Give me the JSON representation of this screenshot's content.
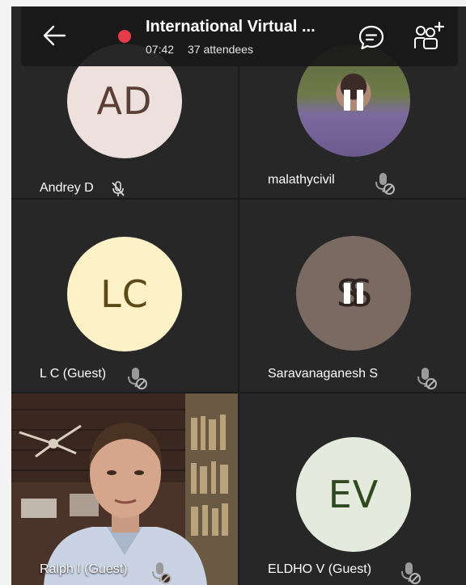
{
  "header": {
    "title": "International Virtual ...",
    "time": "07:42",
    "attendees": "37 attendees"
  },
  "participants": [
    {
      "name": "Andrey D",
      "initials": "AD",
      "mic": "muted-inline",
      "avatar_color": "#ede0dd"
    },
    {
      "name": "malathycivil",
      "initials": "",
      "mic": "muted",
      "video": "paused"
    },
    {
      "name": "L C (Guest)",
      "initials": "LC",
      "mic": "muted",
      "avatar_color": "#fdf1c8"
    },
    {
      "name": "Saravanaganesh S",
      "initials": "SS",
      "mic": "muted",
      "video": "paused",
      "avatar_color": "#7b6a62"
    },
    {
      "name": "Ralph I (Guest)",
      "initials": "",
      "mic": "muted",
      "video": "on"
    },
    {
      "name": "ELDHO V (Guest)",
      "initials": "EV",
      "mic": "muted",
      "avatar_color": "#e4ebdc"
    }
  ],
  "icons": {
    "back": "arrow-left-icon",
    "recording": "recording-dot-icon",
    "chat": "chat-bubble-icon",
    "people": "people-add-icon",
    "mic_off": "mic-off-icon",
    "pause": "pause-icon"
  },
  "colors": {
    "background": "#1b1b1b",
    "tile": "#272727",
    "recording": "#e63a4b"
  }
}
